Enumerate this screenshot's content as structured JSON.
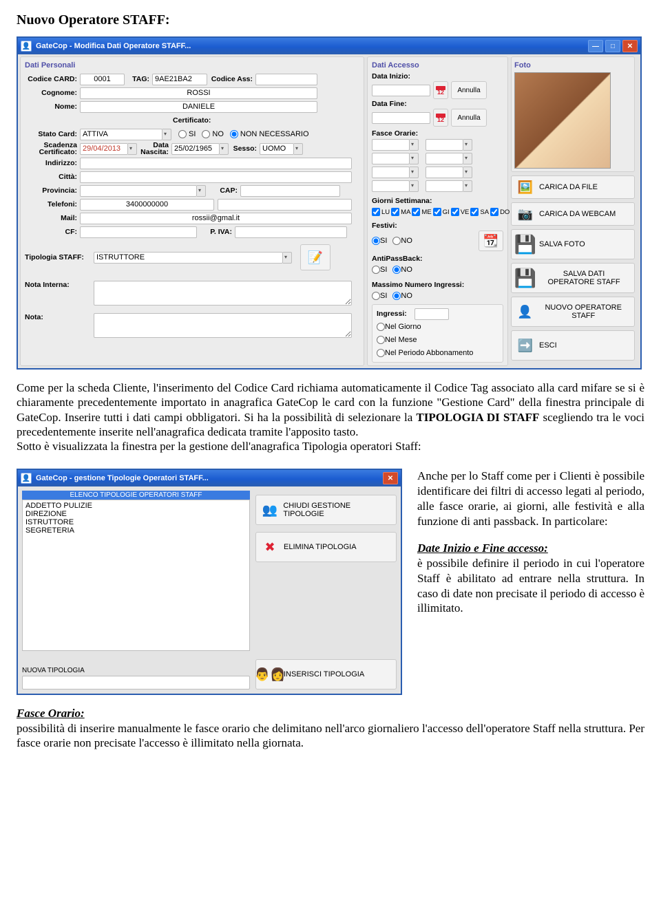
{
  "doc": {
    "heading": "Nuovo Operatore STAFF:",
    "para1_a": "Come per la scheda Cliente, l'inserimento del Codice Card richiama automaticamente il Codice Tag associato alla card mifare se si è chiaramente precedentemente importato in anagrafica GateCop le card con la funzione \"Gestione Card\" della finestra principale di GateCop. Inserire tutti i dati campi obbligatori. Si ha la possibilità di selezionare la ",
    "para1_b": "TIPOLOGIA DI STAFF",
    "para1_c": " scegliendo tra le voci precedentemente inserite nell'anagrafica dedicata tramite l'apposito tasto.",
    "para2": "Sotto è visualizzata la finestra per la gestione dell'anagrafica Tipologia operatori Staff:",
    "side1": "Anche per lo Staff come per i Clienti è possibile identificare dei filtri di accesso legati al periodo, alle fasce orarie, ai giorni, alle festività e alla funzione di anti passback. In particolare:",
    "side2_title": "Date Inizio e Fine accesso:",
    "side2": "è possibile definire il periodo in cui l'operatore Staff è abilitato ad entrare nella struttura. In caso di date non precisate il periodo di accesso è illimitato.",
    "bottom_title": "Fasce Orario:",
    "bottom": "possibilità di inserire manualmente le fasce orario che delimitano nell'arco giornaliero l'accesso dell'operatore Staff nella struttura. Per fasce orarie non precisate l'accesso è illimitato nella giornata."
  },
  "win1": {
    "title": "GateCop - Modifica Dati Operatore STAFF...",
    "sec_personali": "Dati Personali",
    "sec_accesso": "Dati Accesso",
    "sec_foto": "Foto",
    "lbl_codice_card": "Codice CARD:",
    "val_codice_card": "0001",
    "lbl_tag": "TAG:",
    "val_tag": "9AE21BA2",
    "lbl_codice_ass": "Codice Ass:",
    "lbl_cognome": "Cognome:",
    "val_cognome": "ROSSI",
    "lbl_nome": "Nome:",
    "val_nome": "DANIELE",
    "lbl_stato_card": "Stato Card:",
    "val_stato_card": "ATTIVA",
    "lbl_certificato": "Certificato:",
    "opt_si": "SI",
    "opt_no": "NO",
    "opt_non_nec": "NON NECESSARIO",
    "lbl_scad_cert": "Scadenza Certificato:",
    "val_scad_cert": "29/04/2013",
    "lbl_data_nascita": "Data Nascita:",
    "val_data_nascita": "25/02/1965",
    "lbl_sesso": "Sesso:",
    "val_sesso": "UOMO",
    "lbl_indirizzo": "Indirizzo:",
    "lbl_citta": "Città:",
    "lbl_provincia": "Provincia:",
    "lbl_cap": "CAP:",
    "lbl_telefoni": "Telefoni:",
    "val_telefoni": "3400000000",
    "lbl_mail": "Mail:",
    "val_mail": "rossii@gmal.it",
    "lbl_cf": "CF:",
    "lbl_piva": "P. IVA:",
    "lbl_tipologia": "Tipologia STAFF:",
    "val_tipologia": "ISTRUTTORE",
    "lbl_nota_interna": "Nota Interna:",
    "lbl_nota": "Nota:",
    "lbl_data_inizio": "Data Inizio:",
    "lbl_data_fine": "Data Fine:",
    "btn_annulla": "Annulla",
    "lbl_fasce": "Fasce Orarie:",
    "lbl_giorni": "Giorni Settimana:",
    "day_lu": "LU",
    "day_ma": "MA",
    "day_me": "ME",
    "day_gi": "GI",
    "day_ve": "VE",
    "day_sa": "SA",
    "day_do": "DO",
    "lbl_festivi": "Festivi:",
    "lbl_apb": "AntiPassBack:",
    "lbl_max_ing": "Massimo Numero Ingressi:",
    "lbl_ingressi": "Ingressi:",
    "opt_nel_giorno": "Nel Giorno",
    "opt_nel_mese": "Nel Mese",
    "opt_nel_periodo": "Nel Periodo Abbonamento",
    "btn_carica_file": "CARICA DA FILE",
    "btn_carica_webcam": "CARICA DA WEBCAM",
    "btn_salva_foto": "SALVA FOTO",
    "btn_salva_dati": "SALVA DATI OPERATORE STAFF",
    "btn_nuovo_op": "NUOVO OPERATORE STAFF",
    "btn_esci": "ESCI"
  },
  "win2": {
    "title": "GateCop - gestione Tipologie Operatori STAFF...",
    "list_header": "ELENCO TIPOLOGIE OPERATORI STAFF",
    "items": [
      "ADDETTO PULIZIE",
      "DIREZIONE",
      "ISTRUTTORE",
      "SEGRETERIA"
    ],
    "btn_chiudi": "CHIUDI GESTIONE TIPOLOGIE",
    "btn_elimina": "ELIMINA TIPOLOGIA",
    "lbl_nuova": "NUOVA TIPOLOGIA",
    "btn_inserisci": "INSERISCI TIPOLOGIA"
  }
}
